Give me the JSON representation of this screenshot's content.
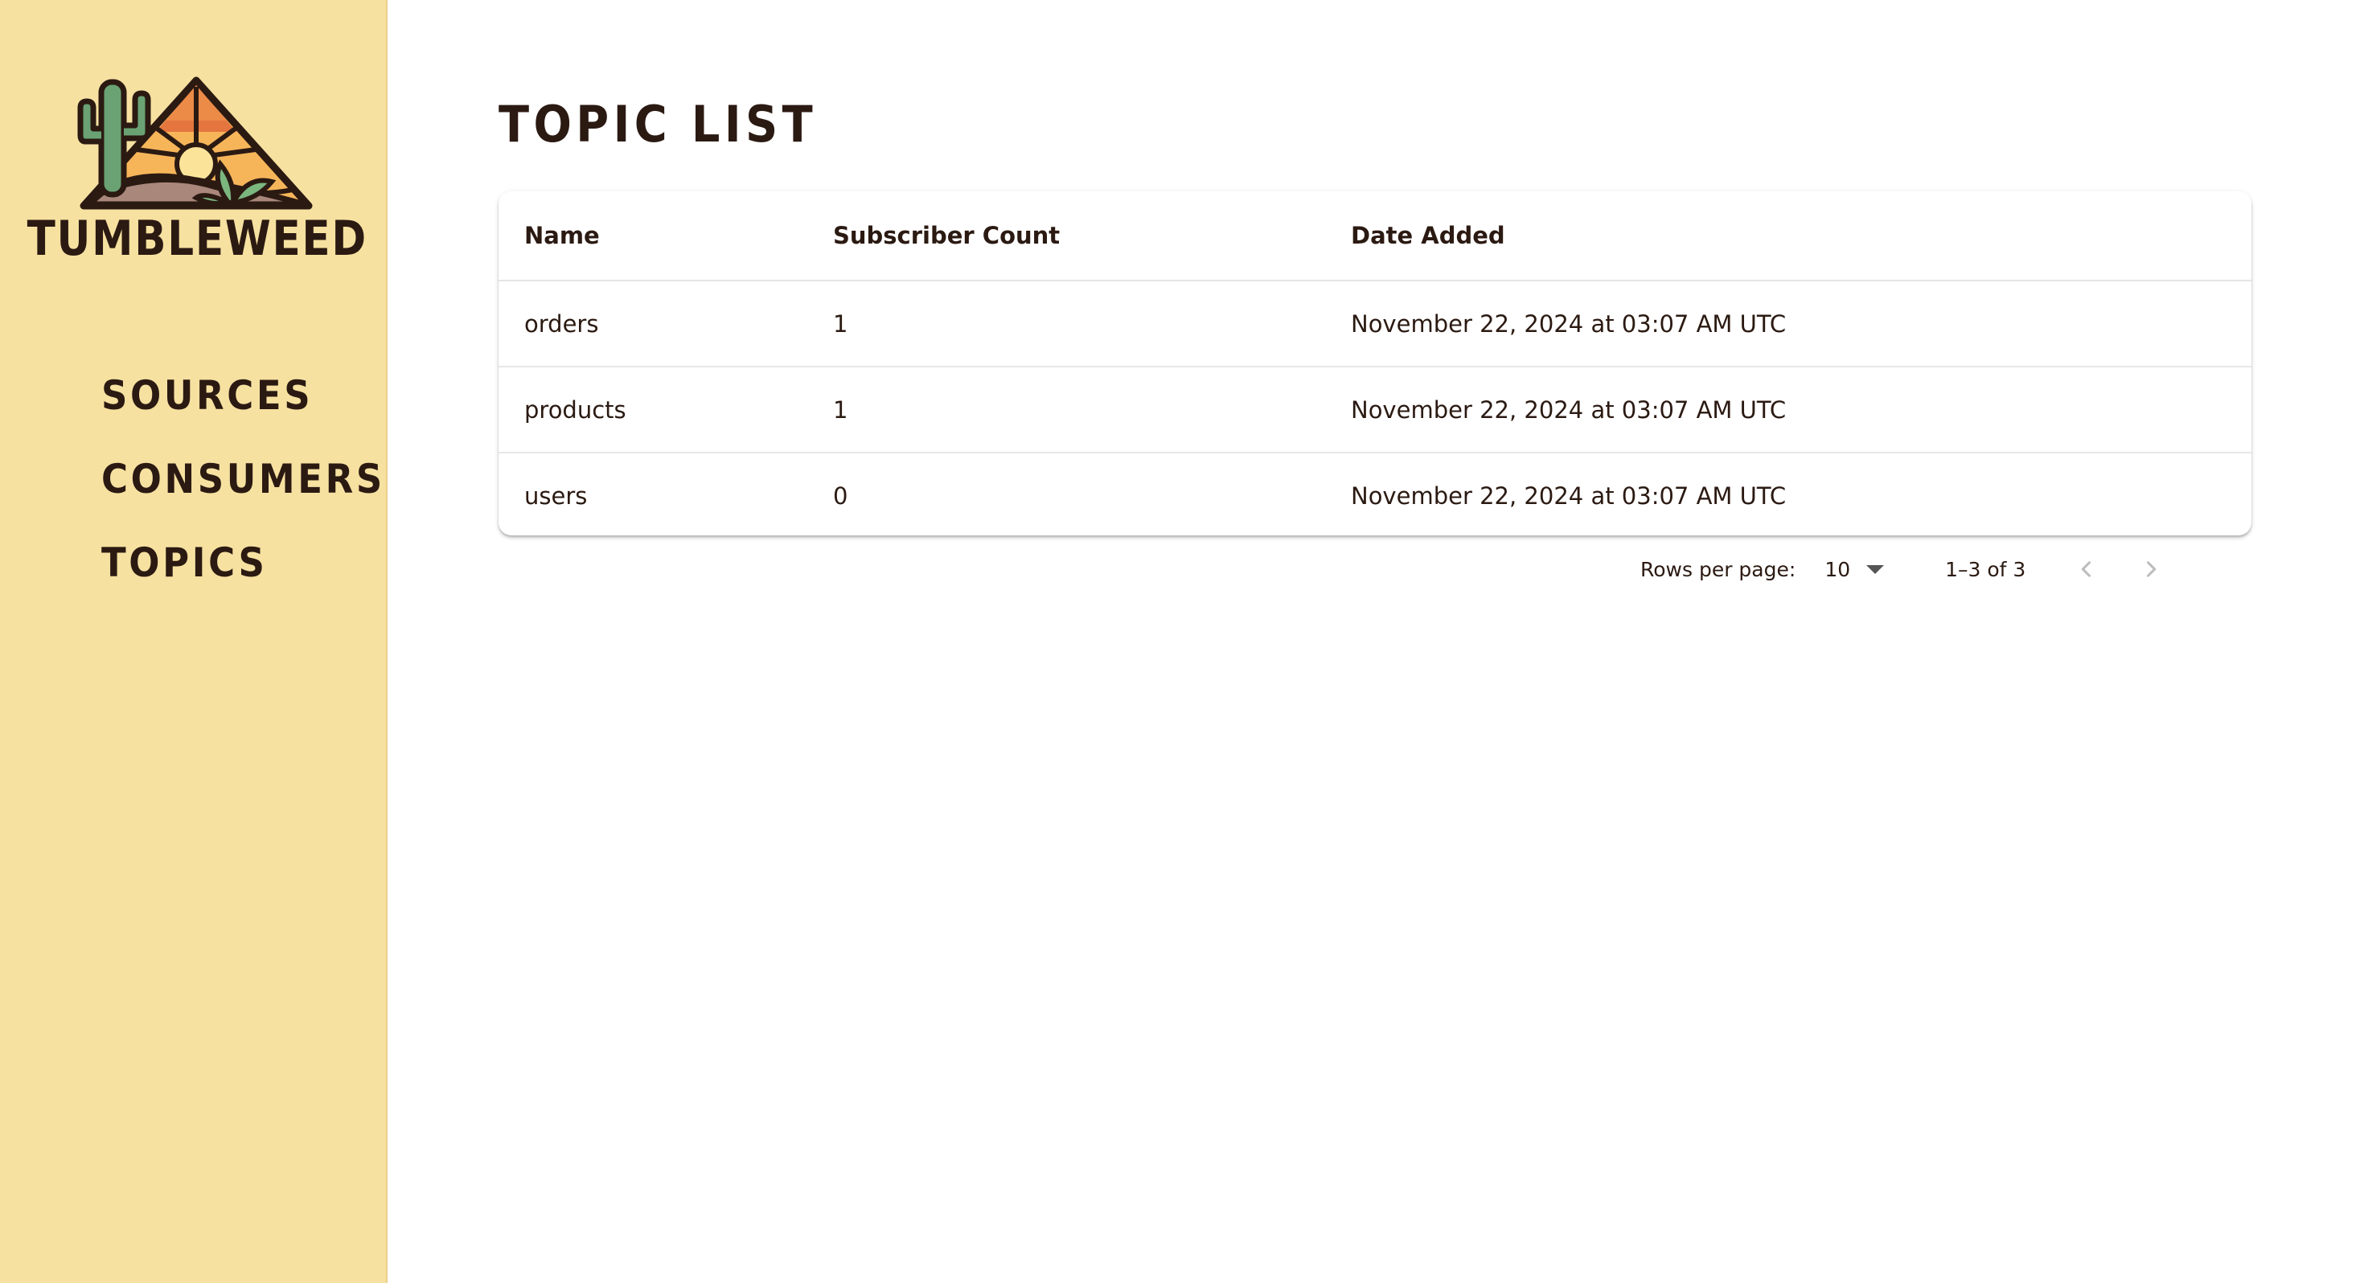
{
  "app": {
    "brand": "TUMBLEWEED"
  },
  "sidebar": {
    "items": [
      {
        "label": "SOURCES"
      },
      {
        "label": "CONSUMERS"
      },
      {
        "label": "TOPICS"
      }
    ]
  },
  "main": {
    "title": "TOPIC LIST",
    "table": {
      "headers": [
        "Name",
        "Subscriber Count",
        "Date Added"
      ],
      "rows": [
        [
          "orders",
          "1",
          "November 22, 2024 at 03:07 AM UTC"
        ],
        [
          "products",
          "1",
          "November 22, 2024 at 03:07 AM UTC"
        ],
        [
          "users",
          "0",
          "November 22, 2024 at 03:07 AM UTC"
        ]
      ]
    },
    "pagination": {
      "rows_per_page_label": "Rows per page:",
      "rows_per_page_value": "10",
      "range": "1–3 of 3"
    }
  },
  "colors": {
    "sidebar_bg": "#f7e1a1",
    "text": "#2b1a12",
    "cactus": "#5a9a6a",
    "sun": "#f0a040",
    "sunset": "#e07040"
  },
  "icons": [
    "tumbleweed-logo",
    "chevron-down-icon",
    "chevron-left-icon",
    "chevron-right-icon"
  ]
}
